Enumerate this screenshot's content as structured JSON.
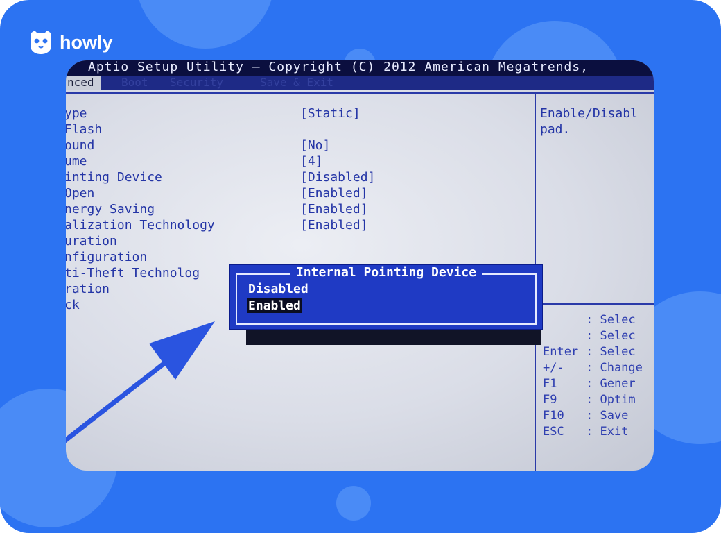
{
  "brand": {
    "name": "howly",
    "icon": "owl-logo-icon"
  },
  "bios": {
    "title": "Aptio Setup Utility – Copyright (C) 2012 American Megatrends,",
    "menu": {
      "active": "nced",
      "faded": [
        "Boot",
        "Security",
        "Save & Exit"
      ]
    },
    "items": [
      {
        "label": "ype",
        "value": "[Static]"
      },
      {
        "label": " Flash",
        "value": ""
      },
      {
        "label": "ound",
        "value": "[No]"
      },
      {
        "label": "ume",
        "value": "[4]"
      },
      {
        "label": "inting Device",
        "value": "[Disabled]"
      },
      {
        "label": " Open",
        "value": "[Enabled]"
      },
      {
        "label": "nergy Saving",
        "value": "[Enabled]"
      },
      {
        "label": "alization Technology",
        "value": "[Enabled]"
      },
      {
        "label": "uration",
        "value": ""
      },
      {
        "label": "nfiguration",
        "value": ""
      },
      {
        "label": "ti-Theft Technolog",
        "value": ""
      },
      {
        "label": "ration",
        "value": ""
      },
      {
        "label": "ck",
        "value": ""
      }
    ],
    "help": [
      "Enable/Disabl",
      "pad."
    ],
    "keys": [
      {
        "key": "",
        "desc": ": Selec"
      },
      {
        "key": "",
        "desc": ": Selec"
      },
      {
        "key": "Enter",
        "desc": ": Selec"
      },
      {
        "key": "+/-",
        "desc": ": Change"
      },
      {
        "key": "F1",
        "desc": ": Gener"
      },
      {
        "key": "F9",
        "desc": ": Optim"
      },
      {
        "key": "F10",
        "desc": ": Save"
      },
      {
        "key": "ESC",
        "desc": ": Exit"
      }
    ],
    "popup": {
      "title": "Internal Pointing Device",
      "options": [
        "Disabled",
        "Enabled"
      ],
      "selected": "Enabled"
    }
  },
  "colors": {
    "frame": "#2c73f2",
    "bios_text": "#2435a6",
    "popup_bg": "#1f3ac4",
    "arrow": "#2a54e0"
  }
}
